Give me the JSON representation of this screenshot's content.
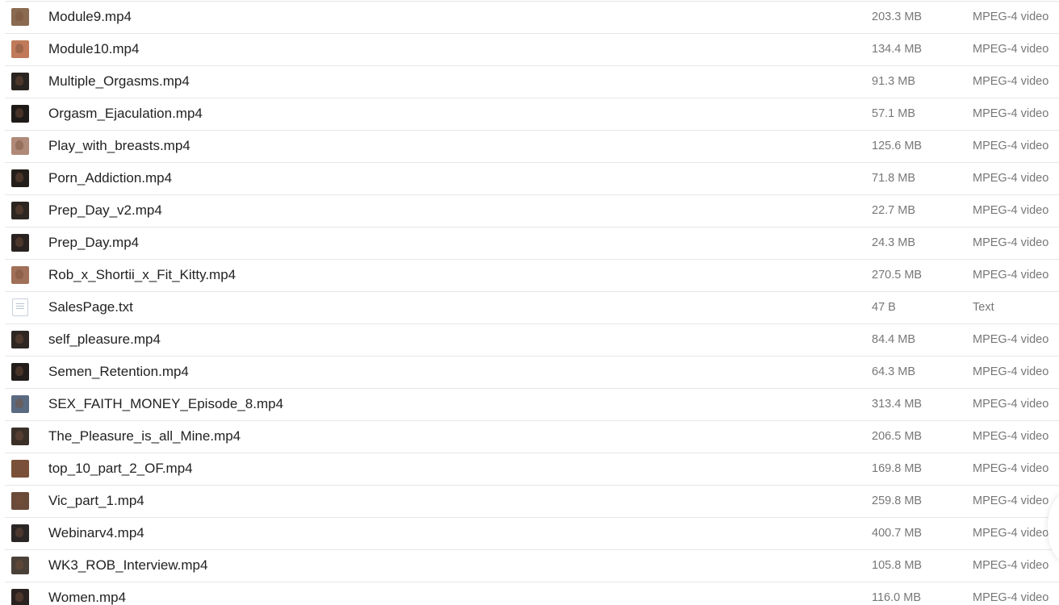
{
  "files": [
    {
      "name": "Module9.mp4",
      "size": "203.3 MB",
      "type": "MPEG-4 video",
      "icon": "video-thumbnail",
      "thumb_color": "#8a6a50"
    },
    {
      "name": "Module10.mp4",
      "size": "134.4 MB",
      "type": "MPEG-4 video",
      "icon": "video-thumbnail",
      "thumb_color": "#c07a5a"
    },
    {
      "name": "Multiple_Orgasms.mp4",
      "size": "91.3 MB",
      "type": "MPEG-4 video",
      "icon": "video-thumbnail",
      "thumb_color": "#2a2420"
    },
    {
      "name": "Orgasm_Ejaculation.mp4",
      "size": "57.1 MB",
      "type": "MPEG-4 video",
      "icon": "video-thumbnail",
      "thumb_color": "#1e1a18"
    },
    {
      "name": "Play_with_breasts.mp4",
      "size": "125.6 MB",
      "type": "MPEG-4 video",
      "icon": "video-thumbnail",
      "thumb_color": "#b08a78"
    },
    {
      "name": "Porn_Addiction.mp4",
      "size": "71.8 MB",
      "type": "MPEG-4 video",
      "icon": "video-thumbnail",
      "thumb_color": "#241e1a"
    },
    {
      "name": "Prep_Day_v2.mp4",
      "size": "22.7 MB",
      "type": "MPEG-4 video",
      "icon": "video-thumbnail",
      "thumb_color": "#2c2520"
    },
    {
      "name": "Prep_Day.mp4",
      "size": "24.3 MB",
      "type": "MPEG-4 video",
      "icon": "video-thumbnail",
      "thumb_color": "#2a2220"
    },
    {
      "name": "Rob_x_Shortii_x_Fit_Kitty.mp4",
      "size": "270.5 MB",
      "type": "MPEG-4 video",
      "icon": "video-thumbnail",
      "thumb_color": "#a07058"
    },
    {
      "name": "SalesPage.txt",
      "size": "47 B",
      "type": "Text",
      "icon": "text-file-icon",
      "thumb_color": "#ffffff"
    },
    {
      "name": "self_pleasure.mp4",
      "size": "84.4 MB",
      "type": "MPEG-4 video",
      "icon": "video-thumbnail",
      "thumb_color": "#2e2622"
    },
    {
      "name": "Semen_Retention.mp4",
      "size": "64.3 MB",
      "type": "MPEG-4 video",
      "icon": "video-thumbnail",
      "thumb_color": "#221c1a"
    },
    {
      "name": "SEX_FAITH_MONEY_Episode_8.mp4",
      "size": "313.4 MB",
      "type": "MPEG-4 video",
      "icon": "video-thumbnail",
      "thumb_color": "#5a6a80"
    },
    {
      "name": "The_Pleasure_is_all_Mine.mp4",
      "size": "206.5 MB",
      "type": "MPEG-4 video",
      "icon": "video-thumbnail",
      "thumb_color": "#3a3028"
    },
    {
      "name": "top_10_part_2_OF.mp4",
      "size": "169.8 MB",
      "type": "MPEG-4 video",
      "icon": "video-thumbnail",
      "thumb_color": "#7a5038"
    },
    {
      "name": "Vic_part_1.mp4",
      "size": "259.8 MB",
      "type": "MPEG-4 video",
      "icon": "video-thumbnail",
      "thumb_color": "#6a4a38"
    },
    {
      "name": "Webinarv4.mp4",
      "size": "400.7 MB",
      "type": "MPEG-4 video",
      "icon": "video-thumbnail",
      "thumb_color": "#2a2626"
    },
    {
      "name": "WK3_ROB_Interview.mp4",
      "size": "105.8 MB",
      "type": "MPEG-4 video",
      "icon": "video-thumbnail",
      "thumb_color": "#4a4038"
    },
    {
      "name": "Women.mp4",
      "size": "116.0 MB",
      "type": "MPEG-4 video",
      "icon": "video-thumbnail",
      "thumb_color": "#2a2220"
    }
  ]
}
